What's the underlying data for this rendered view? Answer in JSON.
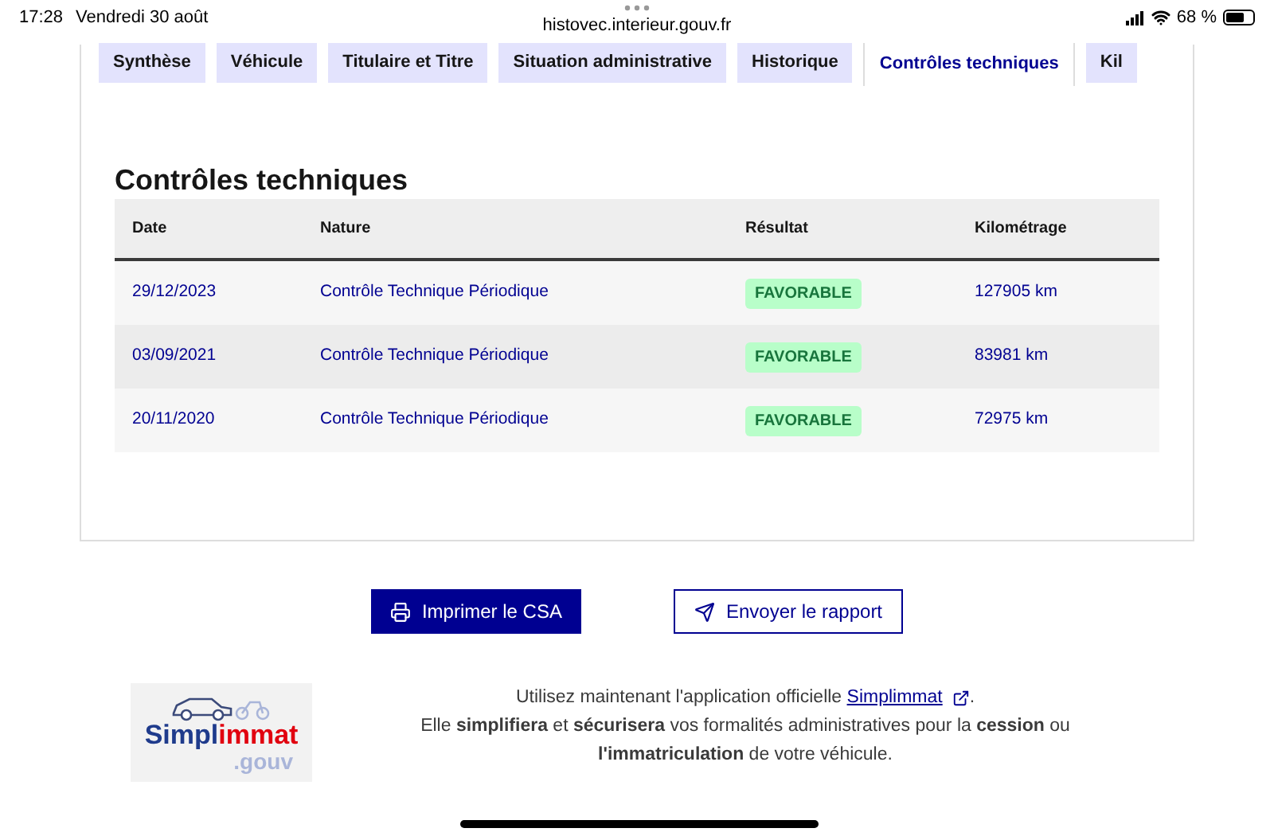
{
  "status_bar": {
    "time": "17:28",
    "date": "Vendredi 30 août",
    "url": "histovec.interieur.gouv.fr",
    "battery": "68 %"
  },
  "tabs": [
    {
      "label": "Synthèse",
      "selected": false
    },
    {
      "label": "Véhicule",
      "selected": false
    },
    {
      "label": "Titulaire et Titre",
      "selected": false
    },
    {
      "label": "Situation administrative",
      "selected": false
    },
    {
      "label": "Historique",
      "selected": false
    },
    {
      "label": "Contrôles techniques",
      "selected": true
    },
    {
      "label": "Kil",
      "selected": false
    }
  ],
  "section_title": "Contrôles techniques",
  "table": {
    "columns": [
      "Date",
      "Nature",
      "Résultat",
      "Kilométrage"
    ],
    "rows": [
      {
        "date": "29/12/2023",
        "nature": "Contrôle Technique Périodique",
        "result": "FAVORABLE",
        "kind": "favorable",
        "mileage": "127905 km"
      },
      {
        "date": "03/09/2021",
        "nature": "Contrôle Technique Périodique",
        "result": "FAVORABLE",
        "kind": "favorable",
        "mileage": "83981 km"
      },
      {
        "date": "20/11/2020",
        "nature": "Contrôle Technique Périodique",
        "result": "FAVORABLE",
        "kind": "favorable",
        "mileage": "72975 km"
      }
    ]
  },
  "buttons": [
    {
      "label": "Imprimer le CSA",
      "kind": "primary"
    },
    {
      "label": "Envoyer le rapport",
      "kind": "secondary"
    }
  ],
  "logo": {
    "part_1": "Simpl",
    "part_2": "immat",
    "suffix": ".gouv"
  },
  "promo": {
    "before_link": "Utilisez maintenant l'application officielle",
    "link": "Simplimmat",
    "after_link": ".",
    "text": "Elle **simplifiera** et **sécurisera** vos formalités administratives pour la **cession** ou **l'immatriculation** de votre véhicule."
  }
}
